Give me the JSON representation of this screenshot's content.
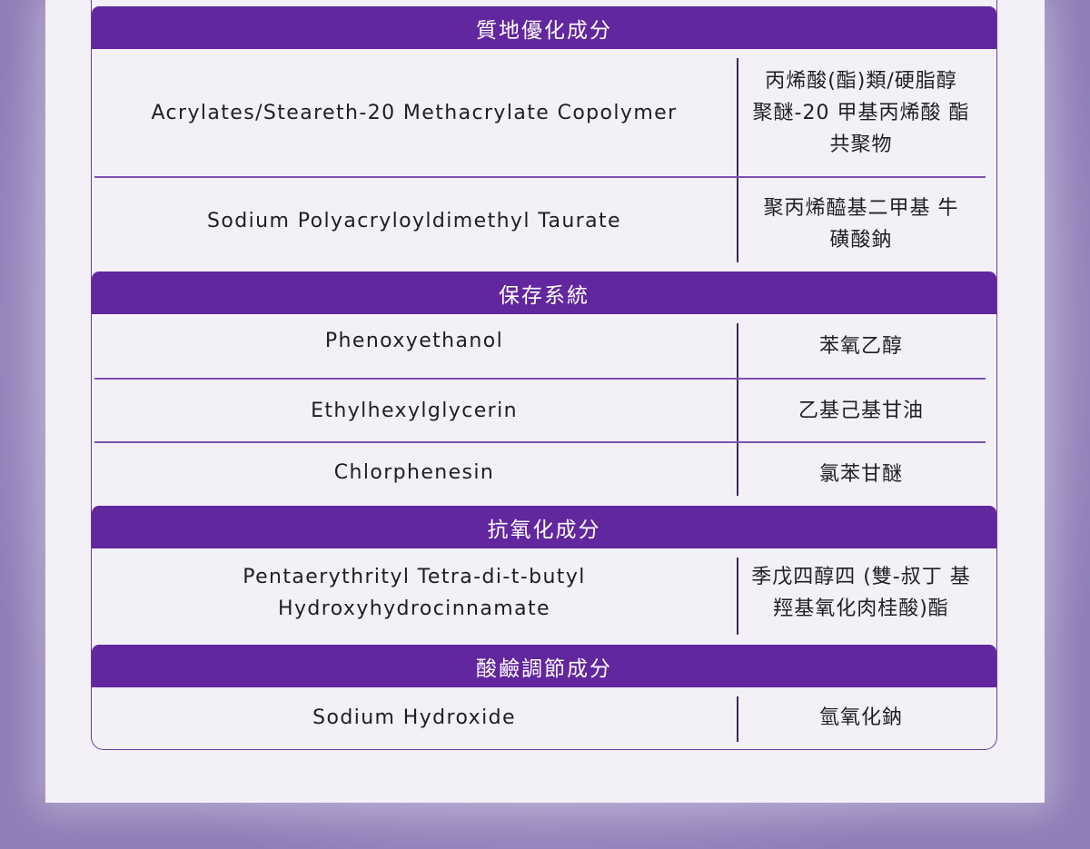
{
  "sections": [
    {
      "title": "質地優化成分",
      "rows": [
        {
          "en": "Acrylates/Steareth-20 Methacrylate Copolymer",
          "zh": "丙烯酸(酯)類/硬脂醇 聚醚-20 甲基丙烯酸 酯共聚物"
        },
        {
          "en": "Sodium Polyacryloyldimethyl Taurate",
          "zh": "聚丙烯醯基二甲基 牛磺酸鈉"
        }
      ]
    },
    {
      "title": "保存系統",
      "rows": [
        {
          "en": "Phenoxyethanol",
          "zh": "苯氧乙醇"
        },
        {
          "en": "Ethylhexylglycerin",
          "zh": "乙基己基甘油"
        },
        {
          "en": "Chlorphenesin",
          "zh": "氯苯甘醚"
        }
      ]
    },
    {
      "title": "抗氧化成分",
      "rows": [
        {
          "en": "Pentaerythrityl Tetra-di-t-butyl Hydroxyhydrocinnamate",
          "zh": "季戊四醇四 (雙-叔丁 基羥基氧化肉桂酸)酯"
        }
      ]
    },
    {
      "title": "酸鹼調節成分",
      "rows": [
        {
          "en": "Sodium Hydroxide",
          "zh": "氫氧化鈉"
        }
      ]
    }
  ],
  "colors": {
    "header_bg": "#62269e",
    "border": "#6b3fa0",
    "panel_bg": "#f3f0f7",
    "outer_bg": "#8e7bb5"
  }
}
